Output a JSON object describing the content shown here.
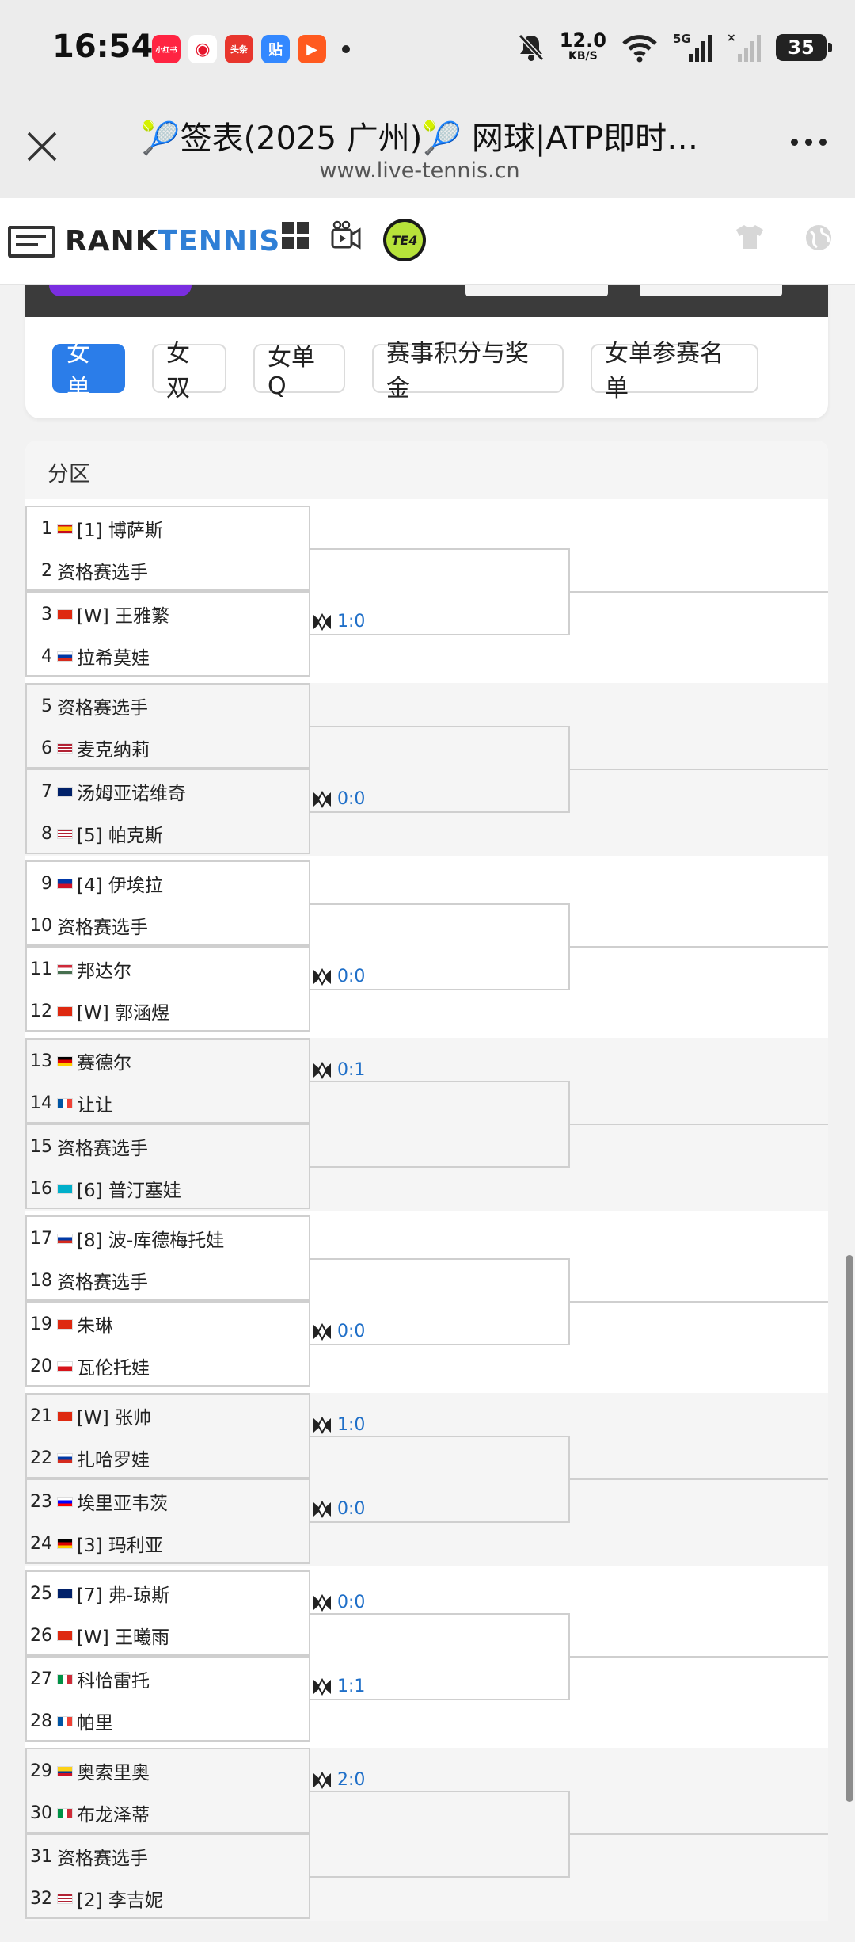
{
  "status_bar": {
    "time": "16:54",
    "apps": [
      {
        "label": "小红书",
        "color": "#ff2442"
      },
      {
        "label": "微博",
        "color": "#f7c948"
      },
      {
        "label": "头条",
        "color": "#e8362d"
      },
      {
        "label": "贴",
        "color": "#3388ff"
      },
      {
        "label": "▶",
        "color": "#ff5a1f"
      }
    ],
    "speed_value": "12.0",
    "speed_unit": "KB/S",
    "network": "5G",
    "battery": "35"
  },
  "browser": {
    "title": "🎾签表(2025 广州)🎾 网球|ATP即时…",
    "url": "www.live-tennis.cn"
  },
  "site": {
    "logo_rank": "RANK",
    "logo_tennis": "TENNIS",
    "te4_label": "TE4"
  },
  "tabs": [
    {
      "label": "女单",
      "active": true
    },
    {
      "label": "女双",
      "active": false
    },
    {
      "label": "女单Q",
      "active": false
    },
    {
      "label": "赛事积分与奖金",
      "active": false
    },
    {
      "label": "女单参赛名单",
      "active": false
    }
  ],
  "draw": {
    "section_label": "分区",
    "groups": [
      {
        "players": [
          {
            "num": "1",
            "flag": "ESP",
            "name": "[1] 博萨斯"
          },
          {
            "num": "2",
            "flag": "",
            "name": "资格赛选手"
          },
          {
            "num": "3",
            "flag": "CHN",
            "name": "[W] 王雅繁"
          },
          {
            "num": "4",
            "flag": "RUS",
            "name": "拉希莫娃"
          }
        ],
        "scores": [
          {
            "slot": "second",
            "text": "1:0"
          }
        ]
      },
      {
        "players": [
          {
            "num": "5",
            "flag": "",
            "name": "资格赛选手"
          },
          {
            "num": "6",
            "flag": "USA",
            "name": "麦克纳莉"
          },
          {
            "num": "7",
            "flag": "AUS",
            "name": "汤姆亚诺维奇"
          },
          {
            "num": "8",
            "flag": "USA",
            "name": "[5] 帕克斯"
          }
        ],
        "scores": [
          {
            "slot": "second",
            "text": "0:0"
          }
        ]
      },
      {
        "players": [
          {
            "num": "9",
            "flag": "PHI",
            "name": "[4] 伊埃拉"
          },
          {
            "num": "10",
            "flag": "",
            "name": "资格赛选手"
          },
          {
            "num": "11",
            "flag": "HUN",
            "name": "邦达尔"
          },
          {
            "num": "12",
            "flag": "CHN",
            "name": "[W] 郭涵煜"
          }
        ],
        "scores": [
          {
            "slot": "second",
            "text": "0:0"
          }
        ]
      },
      {
        "players": [
          {
            "num": "13",
            "flag": "GER",
            "name": "赛德尔"
          },
          {
            "num": "14",
            "flag": "FRA",
            "name": "让让"
          },
          {
            "num": "15",
            "flag": "",
            "name": "资格赛选手"
          },
          {
            "num": "16",
            "flag": "KAZ",
            "name": "[6] 普汀塞娃"
          }
        ],
        "scores": [
          {
            "slot": "first",
            "text": "0:1"
          }
        ]
      },
      {
        "players": [
          {
            "num": "17",
            "flag": "RUS",
            "name": "[8] 波-库德梅托娃"
          },
          {
            "num": "18",
            "flag": "",
            "name": "资格赛选手"
          },
          {
            "num": "19",
            "flag": "CHN",
            "name": "朱琳"
          },
          {
            "num": "20",
            "flag": "CZE",
            "name": "瓦伦托娃"
          }
        ],
        "scores": [
          {
            "slot": "second",
            "text": "0:0"
          }
        ]
      },
      {
        "players": [
          {
            "num": "21",
            "flag": "CHN",
            "name": "[W] 张帅"
          },
          {
            "num": "22",
            "flag": "RUS",
            "name": "扎哈罗娃"
          },
          {
            "num": "23",
            "flag": "SLO",
            "name": "埃里亚韦茨"
          },
          {
            "num": "24",
            "flag": "GER",
            "name": "[3] 玛利亚"
          }
        ],
        "scores": [
          {
            "slot": "first",
            "text": "1:0"
          },
          {
            "slot": "second",
            "text": "0:0"
          }
        ]
      },
      {
        "players": [
          {
            "num": "25",
            "flag": "GBR",
            "name": "[7] 弗-琼斯"
          },
          {
            "num": "26",
            "flag": "CHN",
            "name": "[W] 王曦雨"
          },
          {
            "num": "27",
            "flag": "ITA",
            "name": "科恰雷托"
          },
          {
            "num": "28",
            "flag": "FRA",
            "name": "帕里"
          }
        ],
        "scores": [
          {
            "slot": "first",
            "text": "0:0"
          },
          {
            "slot": "second",
            "text": "1:1"
          }
        ]
      },
      {
        "players": [
          {
            "num": "29",
            "flag": "COL",
            "name": "奥索里奥"
          },
          {
            "num": "30",
            "flag": "ITA",
            "name": "布龙泽蒂"
          },
          {
            "num": "31",
            "flag": "",
            "name": "资格赛选手"
          },
          {
            "num": "32",
            "flag": "USA",
            "name": "[2] 李吉妮"
          }
        ],
        "scores": [
          {
            "slot": "first",
            "text": "2:0"
          }
        ]
      }
    ]
  }
}
